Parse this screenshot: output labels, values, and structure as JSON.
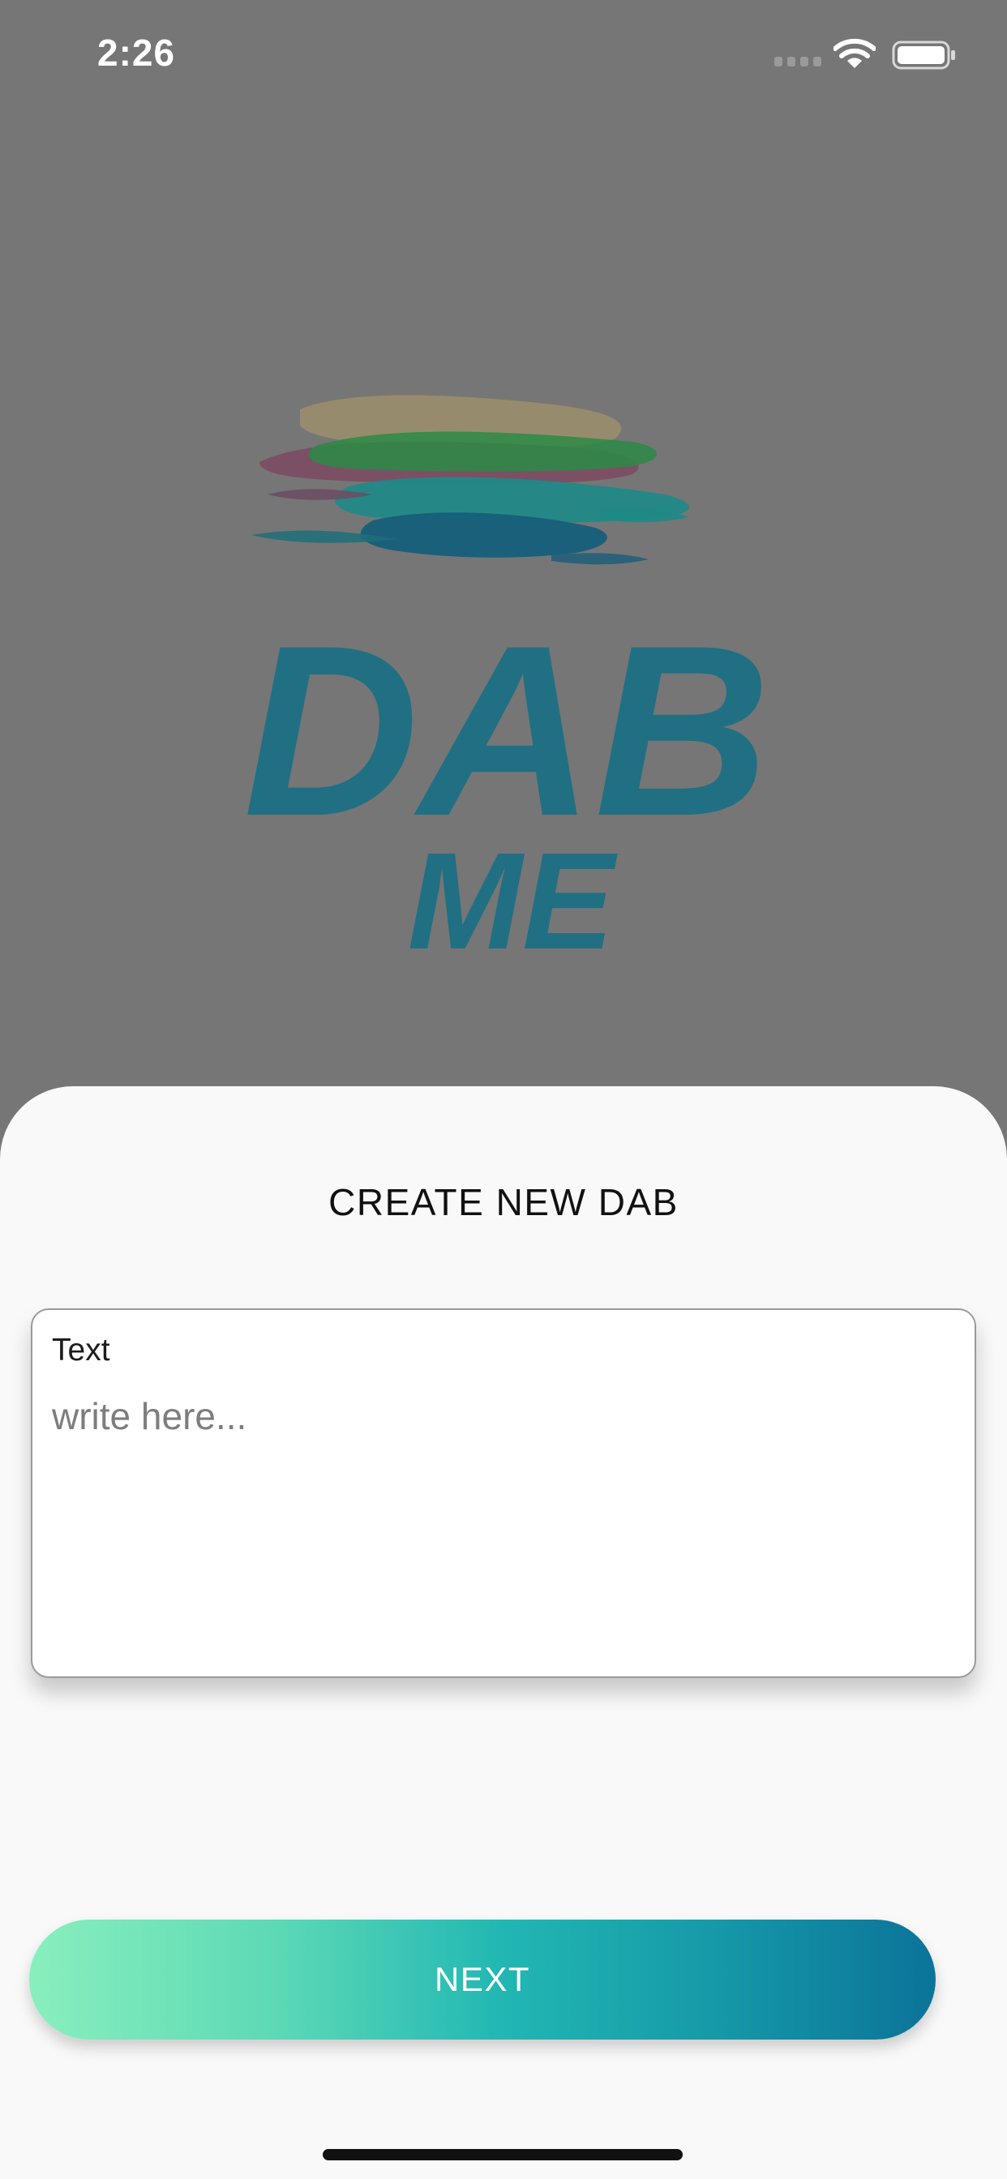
{
  "status_bar": {
    "time": "2:26",
    "icons": [
      "signal-icon",
      "wifi-icon",
      "battery-icon"
    ]
  },
  "logo": {
    "line1": "DAB",
    "line2": "ME",
    "color": "#1a6f85"
  },
  "sheet": {
    "title": "CREATE NEW DAB",
    "text_field": {
      "label": "Text",
      "value": "",
      "placeholder": "write here..."
    },
    "next_button": {
      "label": "NEXT"
    }
  },
  "colors": {
    "background_overlay": "#767676",
    "sheet_background": "#f9f9f9",
    "button_gradient_start": "#89efbe",
    "button_gradient_end": "#0b7399"
  }
}
